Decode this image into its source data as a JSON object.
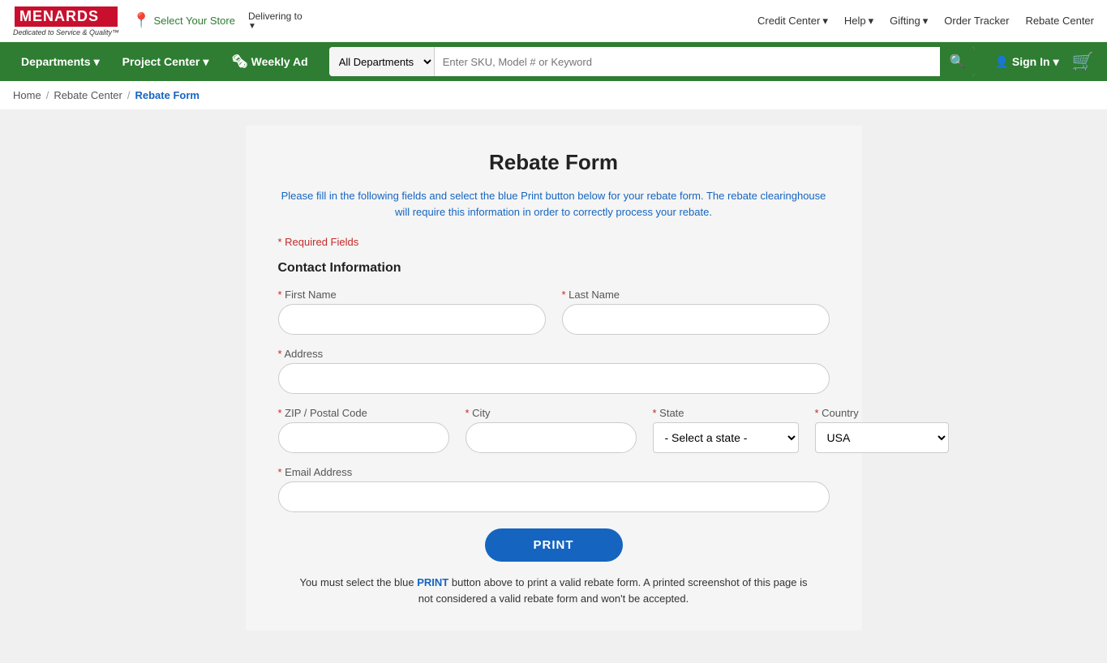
{
  "topBar": {
    "logo": "MENARDS",
    "tagline": "Dedicated to Service & Quality™",
    "storeSelector": "Select Your Store",
    "deliveringTo": "Delivering to",
    "navLinks": [
      {
        "label": "Credit Center",
        "hasChevron": true
      },
      {
        "label": "Help",
        "hasChevron": true
      },
      {
        "label": "Gifting",
        "hasChevron": true
      },
      {
        "label": "Order Tracker",
        "hasChevron": false
      },
      {
        "label": "Rebate Center",
        "hasChevron": false
      }
    ]
  },
  "navBar": {
    "departments": "Departments",
    "projectCenter": "Project Center",
    "weeklyAd": "Weekly Ad",
    "searchPlaceholder": "Enter SKU, Model # or Keyword",
    "allDepartments": "All Departments",
    "signIn": "Sign In"
  },
  "breadcrumb": {
    "home": "Home",
    "rebateCenter": "Rebate Center",
    "current": "Rebate Form"
  },
  "form": {
    "title": "Rebate Form",
    "subtitle": "Please fill in the following fields and select the blue Print button below for your rebate form. The rebate clearinghouse will require this information in order to correctly process your rebate.",
    "requiredNote": "* Required Fields",
    "sectionTitle": "Contact Information",
    "fields": {
      "firstName": "First Name",
      "lastName": "Last Name",
      "address": "Address",
      "zip": "ZIP / Postal Code",
      "city": "City",
      "state": "State",
      "country": "Country",
      "email": "Email Address"
    },
    "stateDefault": "- Select a state -",
    "countryDefault": "USA",
    "printBtn": "PRINT",
    "printNote": "You must select the blue PRINT button above to print a valid rebate form. A printed screenshot of this page is not considered a valid rebate form and won't be accepted."
  }
}
